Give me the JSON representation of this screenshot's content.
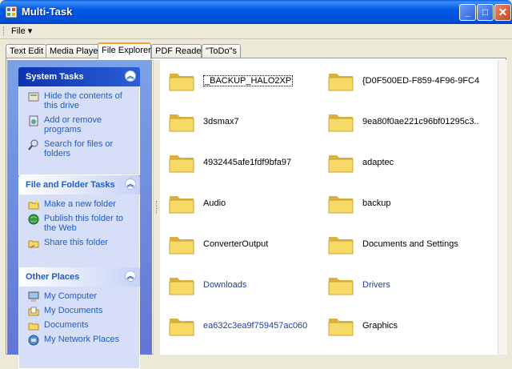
{
  "window": {
    "title": "Multi-Task",
    "controls": [
      "_",
      "□",
      "✕"
    ]
  },
  "menubar": {
    "file_label": "File ▾"
  },
  "tabs": [
    {
      "label": "Text Edit"
    },
    {
      "label": "Media Player"
    },
    {
      "label": "File Explorer",
      "active": true
    },
    {
      "label": "PDF Reader"
    },
    {
      "label": "\"ToDo\"s"
    }
  ],
  "taskpane": {
    "system_tasks": {
      "title": "System Tasks",
      "items": [
        {
          "label": "Hide the contents of this drive",
          "icon": "hide-contents-icon"
        },
        {
          "label": "Add or remove programs",
          "icon": "add-remove-programs-icon"
        },
        {
          "label": "Search for files or folders",
          "icon": "search-icon"
        }
      ]
    },
    "file_folder_tasks": {
      "title": "File and Folder Tasks",
      "items": [
        {
          "label": "Make a new folder",
          "icon": "new-folder-icon"
        },
        {
          "label": "Publish this folder to the Web",
          "icon": "globe-icon"
        },
        {
          "label": "Share this folder",
          "icon": "share-folder-icon"
        }
      ]
    },
    "other_places": {
      "title": "Other Places",
      "items": [
        {
          "label": "My Computer",
          "icon": "computer-icon"
        },
        {
          "label": "My Documents",
          "icon": "documents-icon"
        },
        {
          "label": "Documents",
          "icon": "folder-icon"
        },
        {
          "label": "My Network Places",
          "icon": "network-icon"
        }
      ]
    }
  },
  "files": [
    {
      "name": "_BACKUP_HALO2XP",
      "selected": true
    },
    {
      "name": "{D0F500ED-F859-4F96-9FC4-..."
    },
    {
      "name": "3dsmax7"
    },
    {
      "name": "9ea80f0ae221c96bf01295c3..."
    },
    {
      "name": "4932445afe1fdf9bfa97"
    },
    {
      "name": "adaptec"
    },
    {
      "name": "Audio"
    },
    {
      "name": "backup"
    },
    {
      "name": "ConverterOutput"
    },
    {
      "name": "Documents and Settings"
    },
    {
      "name": "Downloads",
      "link": true
    },
    {
      "name": "Drivers",
      "link": true
    },
    {
      "name": "ea632c3ea9f759457ac060",
      "link": true
    },
    {
      "name": "Graphics"
    }
  ],
  "colors": {
    "folder": "#f7d967",
    "folder_dark": "#d9b13b",
    "link": "#1c3fa0",
    "taskpane_link": "#215dc6"
  }
}
